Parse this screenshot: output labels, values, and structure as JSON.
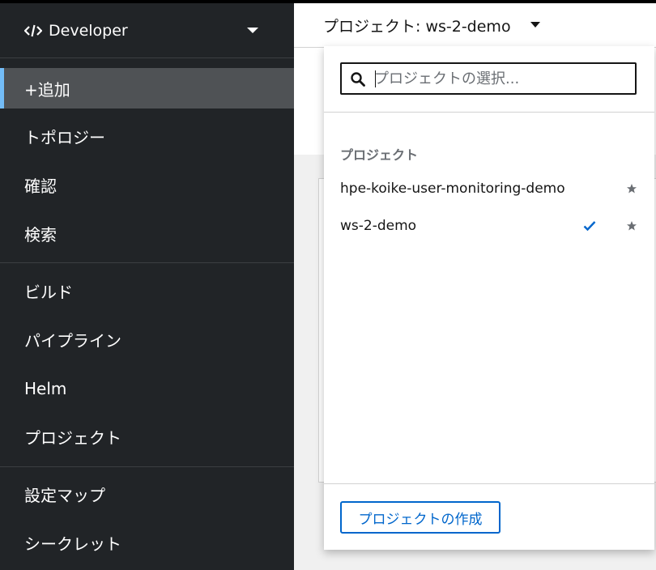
{
  "sidebar": {
    "perspective": "Developer",
    "items": [
      {
        "label": "+追加"
      },
      {
        "label": "トポロジー"
      },
      {
        "label": "確認"
      },
      {
        "label": "検索"
      },
      {
        "label": "ビルド"
      },
      {
        "label": "パイプライン"
      },
      {
        "label": "Helm"
      },
      {
        "label": "プロジェクト"
      },
      {
        "label": "設定マップ"
      },
      {
        "label": "シークレット"
      }
    ]
  },
  "topbar": {
    "project_toggle": "プロジェクト: ws-2-demo"
  },
  "dropdown": {
    "search_placeholder": "プロジェクトの選択...",
    "group_title": "プロジェクト",
    "projects": [
      {
        "name": "hpe-koike-user-monitoring-demo",
        "selected": false
      },
      {
        "name": "ws-2-demo",
        "selected": true
      }
    ],
    "create_label": "プロジェクトの作成"
  },
  "colors": {
    "sidebar_bg": "#212427",
    "active_item_bg": "#4f5255",
    "active_accent": "#73bcf7",
    "link_blue": "#0066cc"
  }
}
